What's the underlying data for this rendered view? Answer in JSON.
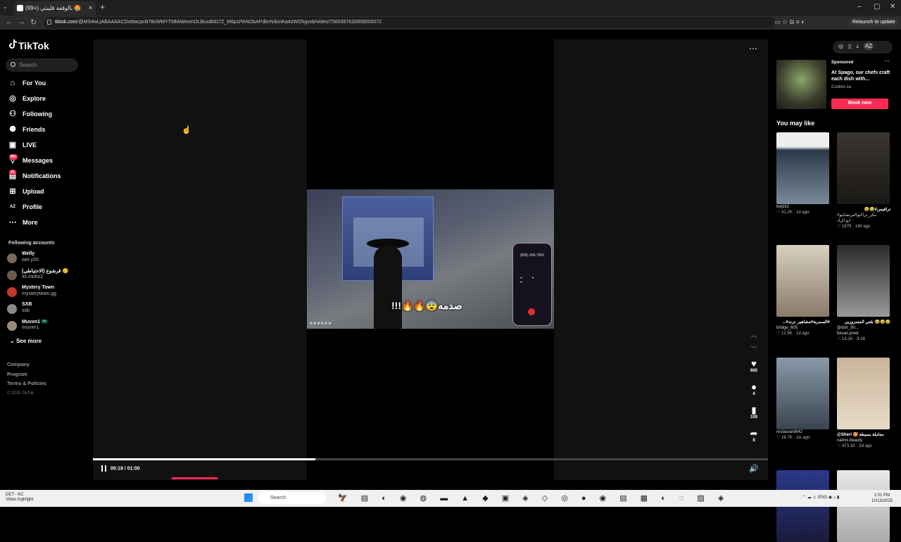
{
  "browser": {
    "tab_title": "(99+) بالوقفة قليبتي 🤩",
    "tab_close": "×",
    "new_tab": "+",
    "url_domain": "tiktok.com",
    "url_path": "/@MS4wLjABAAAACDxt6acpcB78cWMYTMkkWexmDLBcxdND7Z_M6p1PANObAPdknN3onKa4zWOhgvob/video/7560397632859000072",
    "relaunch_label": "Relaunch to update",
    "window_controls": [
      "–",
      "▢",
      "✕"
    ]
  },
  "sidebar": {
    "logo": "TikTok",
    "search_placeholder": "Search",
    "nav": [
      {
        "label": "For You",
        "icon": "home-icon",
        "glyph": "⌂"
      },
      {
        "label": "Explore",
        "icon": "compass-icon",
        "glyph": "◎"
      },
      {
        "label": "Following",
        "icon": "following-icon",
        "glyph": "⚇"
      },
      {
        "label": "Friends",
        "icon": "friends-icon",
        "glyph": "⚉"
      },
      {
        "label": "LIVE",
        "icon": "live-icon",
        "glyph": "▣"
      },
      {
        "label": "Messages",
        "icon": "messages-icon",
        "glyph": "▽",
        "badge": "99+"
      },
      {
        "label": "Notifications",
        "icon": "notifications-icon",
        "glyph": "▤",
        "badge": "16"
      },
      {
        "label": "Upload",
        "icon": "upload-icon",
        "glyph": "⊞"
      },
      {
        "label": "Profile",
        "icon": "profile-icon",
        "glyph": "AZ"
      },
      {
        "label": "More",
        "icon": "more-icon",
        "glyph": "⋯"
      }
    ],
    "following_title": "Following accounts",
    "accounts": [
      {
        "name": "Welly",
        "handle": "wel.y20",
        "color": "#7a6a5a"
      },
      {
        "name": "قرشوع (الاحتياطي) 😊",
        "handle": "its.moho2",
        "color": "#6b5a4a"
      },
      {
        "name": "Mystery Town",
        "handle": "mysterytown.gg",
        "color": "#c0392b"
      },
      {
        "name": "SXB",
        "handle": "sxb",
        "color": "#8a8a8a"
      },
      {
        "name": "Muvxn1 🇸🇦",
        "handle": "muvxn1",
        "color": "#9a8a7a"
      }
    ],
    "see_more": "See more",
    "footer": [
      "Company",
      "Program",
      "Terms & Policies"
    ],
    "copyright": "© 2025 TikTok"
  },
  "player": {
    "phone_number": "(858) 458-7962",
    "caption": "صدمه😨🔥🔥!!!",
    "time_current": "00:19",
    "time_total": "01:00",
    "progress": 0.33,
    "actions": [
      {
        "icon": "heart-icon",
        "glyph": "♥",
        "count": "665"
      },
      {
        "icon": "comment-icon",
        "glyph": "●",
        "count": "4"
      },
      {
        "icon": "bookmark-icon",
        "glyph": "▮",
        "count": "109"
      },
      {
        "icon": "share-icon",
        "glyph": "➦",
        "count": "8"
      }
    ]
  },
  "right": {
    "ad": {
      "sponsored": "Sponsored",
      "title": "At Spago, our chefs craft each dish with...",
      "domain": "Coolinc.sa",
      "button": "Book now"
    },
    "may_like_title": "You may like",
    "cards": [
      {
        "title": "",
        "user": "kwjzk2",
        "likes": "41.2K",
        "age": "1d ago",
        "rtl": false,
        "bg": "linear-gradient(180deg,#eee 0%,#eee 20%,#2a3a4a 25%,#7a8a9a 100%)"
      },
      {
        "title": "ترافيس#😂😂",
        "user": "#بنكر_تراكيو#مرتشانيو",
        "extra": "ابو الزاد",
        "likes": "1879",
        "age": "14h ago",
        "rtl": true,
        "bg": "linear-gradient(180deg,#3a3530,#1a1815)"
      },
      {
        "title": "#السمرية#مشاهير_ترند#...",
        "user": "bridge_605",
        "likes": "12.5K",
        "age": "1d ago",
        "rtl": true,
        "bg": "linear-gradient(180deg,#d8d0c0,#8a7a6a)"
      },
      {
        "title": "😂😂😂 بلعي المسرورين",
        "user": "@dsh_90...",
        "extra": "besan.powr",
        "likes": "13.1K",
        "age": "9-28",
        "rtl": true,
        "bg": "linear-gradient(180deg,#2a2a2a,#9a9a9a)"
      },
      {
        "title": "",
        "user": "restaurant642",
        "likes": "16.7K",
        "age": "1w ago",
        "rtl": false,
        "bg": "linear-gradient(180deg,#8a9aa8,#3a4450)"
      },
      {
        "title": "@Sheri 🥰 معاملة بسيطة",
        "user": "narins.beauty",
        "likes": "473.1K",
        "age": "2d ago",
        "rtl": false,
        "bg": "linear-gradient(180deg,#c9b49a,#e8dcc8)"
      },
      {
        "title": "",
        "user": "",
        "likes": "",
        "age": "",
        "rtl": false,
        "bg": "linear-gradient(180deg,#2a3a8a,#1a1a3a)"
      },
      {
        "title": "",
        "user": "",
        "likes": "",
        "age": "",
        "rtl": false,
        "bg": "linear-gradient(180deg,#e8e8e8,#aaa)"
      }
    ]
  },
  "taskbar": {
    "weather_temp": "DET - KC",
    "weather_sub": "Video highlight",
    "search": "Search",
    "apps": "🦅 ▤ ◐ ◉ ◍ ▬ ▲ ◆ ▣ ◈ ◇ ◎ ● ◉ ▤ ▦ ◐ ◌ ▨ ◈",
    "tray": "⌃ ☁ ☺ ENG ◉ ⌂ ▮",
    "time": "1:01 PM",
    "date": "10/13/2025"
  }
}
